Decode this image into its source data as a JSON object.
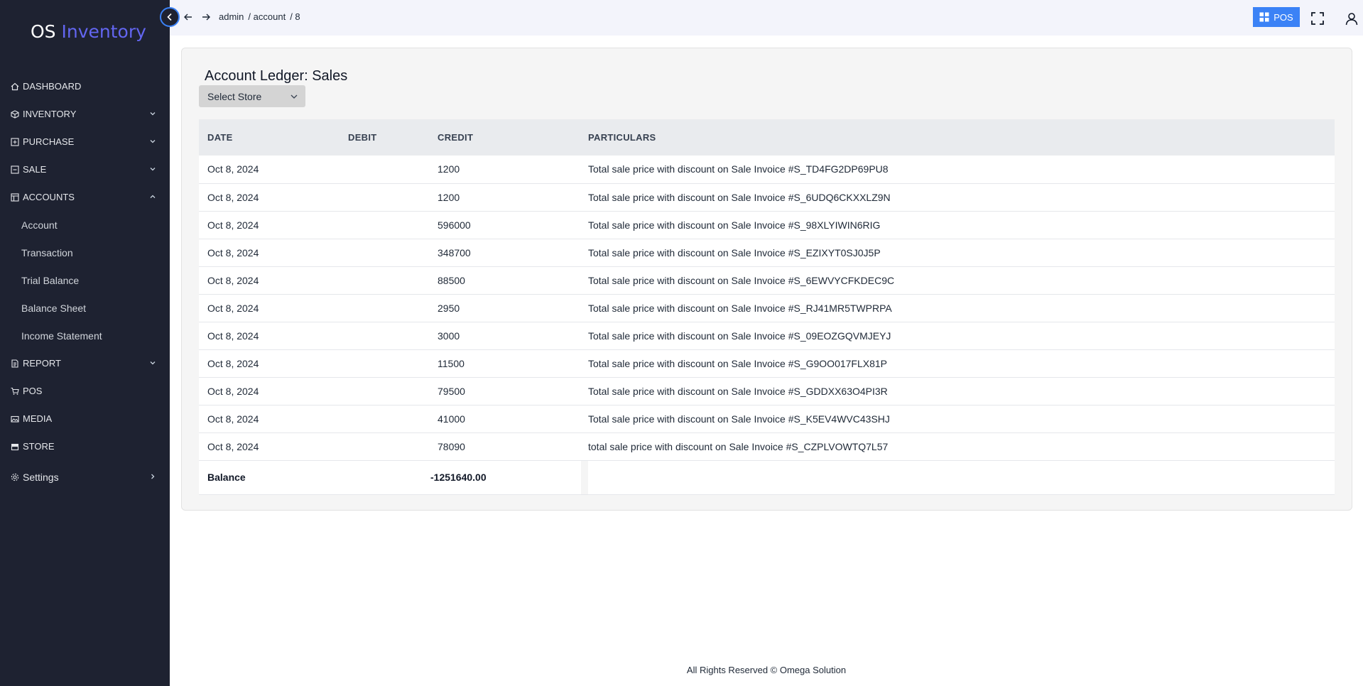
{
  "app": {
    "logo_prefix": "OS",
    "logo_accent": "Inventory",
    "accent_color": "#6366f1"
  },
  "sidebar": {
    "items": [
      {
        "label": "DASHBOARD",
        "icon": "home-icon"
      },
      {
        "label": "INVENTORY",
        "icon": "box-icon"
      },
      {
        "label": "PURCHASE",
        "icon": "plus-square-icon"
      },
      {
        "label": "SALE",
        "icon": "minus-square-icon"
      },
      {
        "label": "ACCOUNTS",
        "icon": "ledger-icon"
      },
      {
        "label": "REPORT",
        "icon": "report-icon"
      },
      {
        "label": "POS",
        "icon": "cart-icon"
      },
      {
        "label": "MEDIA",
        "icon": "media-icon"
      },
      {
        "label": "STORE",
        "icon": "store-icon"
      },
      {
        "label": "Settings",
        "icon": "gear-icon"
      }
    ],
    "accounts_sub": [
      "Account",
      "Transaction",
      "Trial Balance",
      "Balance Sheet",
      "Income Statement"
    ]
  },
  "topbar": {
    "breadcrumb": [
      "admin",
      "/ account",
      "/ 8"
    ],
    "pos_label": "POS"
  },
  "page": {
    "title": "Account Ledger: Sales",
    "select_store": "Select Store"
  },
  "table": {
    "headers": [
      "DATE",
      "DEBIT",
      "CREDIT",
      "PARTICULARS"
    ],
    "rows": [
      {
        "date": "Oct 8, 2024",
        "debit": "",
        "credit": "1200",
        "particulars": "Total sale price with discount on Sale Invoice #S_TD4FG2DP69PU8"
      },
      {
        "date": "Oct 8, 2024",
        "debit": "",
        "credit": "1200",
        "particulars": "Total sale price with discount on Sale Invoice #S_6UDQ6CKXXLZ9N"
      },
      {
        "date": "Oct 8, 2024",
        "debit": "",
        "credit": "596000",
        "particulars": "Total sale price with discount on Sale Invoice #S_98XLYIWIN6RIG"
      },
      {
        "date": "Oct 8, 2024",
        "debit": "",
        "credit": "348700",
        "particulars": "Total sale price with discount on Sale Invoice #S_EZIXYT0SJ0J5P"
      },
      {
        "date": "Oct 8, 2024",
        "debit": "",
        "credit": "88500",
        "particulars": "Total sale price with discount on Sale Invoice #S_6EWVYCFKDEC9C"
      },
      {
        "date": "Oct 8, 2024",
        "debit": "",
        "credit": "2950",
        "particulars": "Total sale price with discount on Sale Invoice #S_RJ41MR5TWPRPA"
      },
      {
        "date": "Oct 8, 2024",
        "debit": "",
        "credit": "3000",
        "particulars": "Total sale price with discount on Sale Invoice #S_09EOZGQVMJEYJ"
      },
      {
        "date": "Oct 8, 2024",
        "debit": "",
        "credit": "11500",
        "particulars": "Total sale price with discount on Sale Invoice #S_G9OO017FLX81P"
      },
      {
        "date": "Oct 8, 2024",
        "debit": "",
        "credit": "79500",
        "particulars": "Total sale price with discount on Sale Invoice #S_GDDXX63O4PI3R"
      },
      {
        "date": "Oct 8, 2024",
        "debit": "",
        "credit": "41000",
        "particulars": "Total sale price with discount on Sale Invoice #S_K5EV4WVC43SHJ"
      },
      {
        "date": "Oct 8, 2024",
        "debit": "",
        "credit": "78090",
        "particulars": "total sale price with discount on Sale Invoice #S_CZPLVOWTQ7L57"
      }
    ],
    "balance_label": "Balance",
    "balance_value": "-1251640.00"
  },
  "footer": {
    "text": "All Rights Reserved © Omega Solution"
  }
}
